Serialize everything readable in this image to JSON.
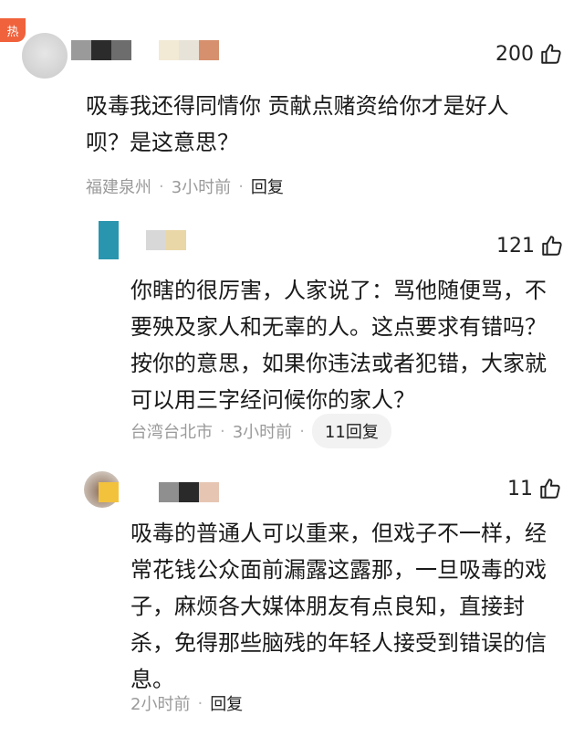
{
  "badge": {
    "hot": "热"
  },
  "comments": [
    {
      "likes": "200",
      "text": "吸毒我还得同情你 贡献点赌资给你才是好人呗？是这意思？",
      "location": "福建泉州",
      "time": "3小时前",
      "reply_label": "回复"
    },
    {
      "likes": "121",
      "text": "你瞎的很厉害，人家说了：骂他随便骂，不要殃及家人和无辜的人。这点要求有错吗？按你的意思，如果你违法或者犯错，大家就可以用三字经问候你的家人？",
      "location": "台湾台北市",
      "time": "3小时前",
      "reply_label": "11回复"
    },
    {
      "likes": "11",
      "text": "吸毒的普通人可以重来，但戏子不一样，经常花钱公众面前漏露这露那，一旦吸毒的戏子，麻烦各大媒体朋友有点良知，直接封杀，免得那些脑残的年轻人接受到错误的信息。",
      "time": "2小时前",
      "reply_label": "回复"
    }
  ],
  "icons": {
    "like": "thumbs-up-icon"
  }
}
